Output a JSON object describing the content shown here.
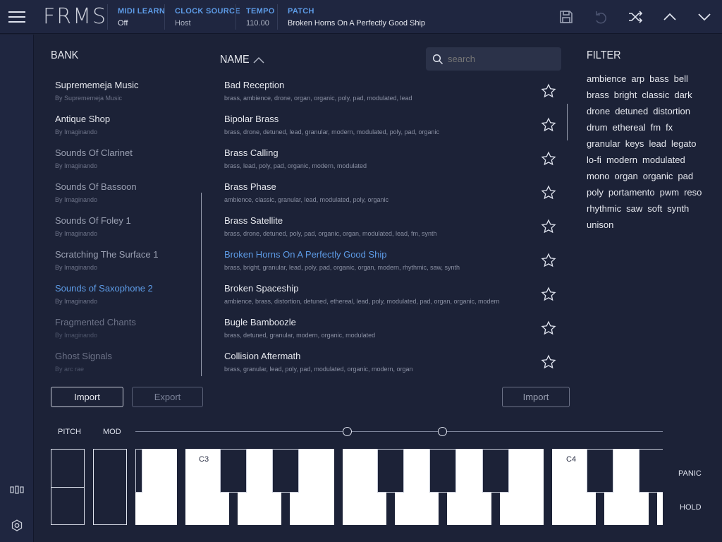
{
  "header": {
    "logo": "FRMS",
    "midi_learn": {
      "label": "MIDI LEARN",
      "value": "Off"
    },
    "clock_source": {
      "label": "CLOCK SOURCE",
      "value": "Host"
    },
    "tempo": {
      "label": "TEMPO",
      "value": "110.00"
    },
    "patch": {
      "label": "PATCH",
      "value": "Broken Horns On A Perfectly Good Ship"
    },
    "icons": [
      "save-icon",
      "undo-icon",
      "shuffle-icon",
      "chevron-up-icon",
      "chevron-down-icon"
    ]
  },
  "bank": {
    "title": "BANK",
    "items": [
      {
        "name": "Suprememeja Music",
        "by": "By Suprememeja Music"
      },
      {
        "name": "Antique Shop",
        "by": "By Imaginando"
      },
      {
        "name": "Sounds Of Clarinet",
        "by": "By Imaginando"
      },
      {
        "name": "Sounds Of Bassoon",
        "by": "By Imaginando"
      },
      {
        "name": "Sounds Of Foley 1",
        "by": "By Imaginando"
      },
      {
        "name": "Scratching The Surface 1",
        "by": "By Imaginando"
      },
      {
        "name": "Sounds of Saxophone 2",
        "by": "By Imaginando"
      },
      {
        "name": "Fragmented Chants",
        "by": "By Imaginando"
      },
      {
        "name": "Ghost Signals",
        "by": "By arc rae"
      }
    ],
    "import_label": "Import",
    "export_label": "Export"
  },
  "patches": {
    "title": "NAME",
    "search_placeholder": "search",
    "items": [
      {
        "name": "Bad Reception",
        "tags": "brass, ambience, drone, organ, organic, poly, pad, modulated, lead"
      },
      {
        "name": "Bipolar Brass",
        "tags": "brass, drone, detuned, lead, granular, modern, modulated, poly, pad, organic"
      },
      {
        "name": "Brass Calling",
        "tags": "brass, lead, poly, pad, organic, modern, modulated"
      },
      {
        "name": "Brass Phase",
        "tags": "ambience, classic, granular, lead, modulated, poly, organic"
      },
      {
        "name": "Brass Satellite",
        "tags": "brass, drone, detuned, poly, pad, organic, organ, modulated, lead, fm, synth"
      },
      {
        "name": "Broken Horns On A Perfectly Good Ship",
        "tags": "brass, bright, granular, lead, poly, pad, organic, organ, modern, rhythmic, saw, synth"
      },
      {
        "name": "Broken Spaceship",
        "tags": "ambience, brass, distortion, detuned, ethereal, lead, poly, modulated, pad, organ, organic, modern"
      },
      {
        "name": "Bugle Bamboozle",
        "tags": "brass, detuned, granular, modern, organic, modulated"
      },
      {
        "name": "Collision Aftermath",
        "tags": "brass, granular, lead, poly, pad, modulated, organic, modern, organ"
      }
    ],
    "import_label": "Import"
  },
  "filter": {
    "title": "FILTER",
    "rows": [
      [
        "ambience",
        "arp",
        "bass",
        "bell"
      ],
      [
        "brass",
        "bright",
        "classic",
        "dark"
      ],
      [
        "drone",
        "detuned",
        "distortion"
      ],
      [
        "drum",
        "ethereal",
        "fm",
        "fx"
      ],
      [
        "granular",
        "keys",
        "lead",
        "legato"
      ],
      [
        "lo-fi",
        "modern",
        "modulated"
      ],
      [
        "mono",
        "organ",
        "organic",
        "pad"
      ],
      [
        "poly",
        "portamento",
        "pwm",
        "reso"
      ],
      [
        "rhythmic",
        "saw",
        "soft",
        "synth"
      ],
      [
        "unison"
      ]
    ]
  },
  "keyboard": {
    "pitch_label": "PITCH",
    "mod_label": "MOD",
    "c3_label": "C3",
    "c4_label": "C4",
    "panic_label": "PANIC",
    "hold_label": "HOLD"
  },
  "colors": {
    "accent": "#5d9be6",
    "background": "#1c2237",
    "header": "#1f2640"
  }
}
